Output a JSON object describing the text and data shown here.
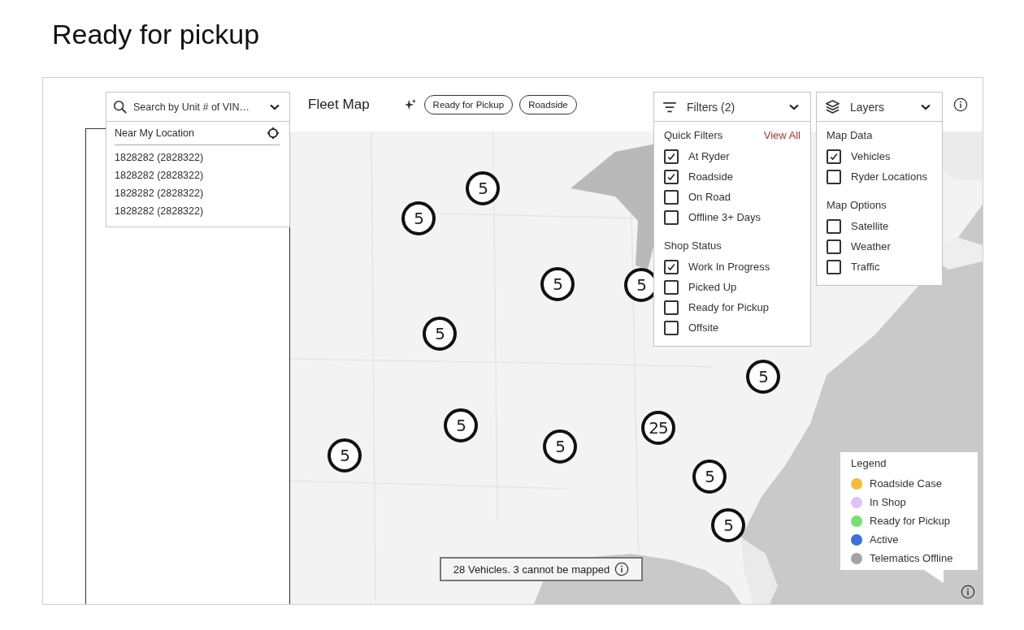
{
  "heading": "Ready for pickup",
  "search": {
    "placeholder": "Search by Unit # of VIN…",
    "near_location": "Near My Location",
    "results": [
      "1828282 (2828322)",
      "1828282 (2828322)",
      "1828282 (2828322)",
      "1828282 (2828322)"
    ]
  },
  "toolbar": {
    "title": "Fleet Map",
    "chips": [
      "Ready for Pickup",
      "Roadside"
    ]
  },
  "filters": {
    "label": "Filters (2)",
    "sections": [
      {
        "title": "Quick Filters",
        "link": "View All",
        "options": [
          {
            "label": "At Ryder",
            "checked": true
          },
          {
            "label": "Roadside",
            "checked": true
          },
          {
            "label": "On Road",
            "checked": false
          },
          {
            "label": "Offline 3+ Days",
            "checked": false
          }
        ]
      },
      {
        "title": "Shop Status",
        "options": [
          {
            "label": "Work In Progress",
            "checked": true
          },
          {
            "label": "Picked Up",
            "checked": false
          },
          {
            "label": "Ready for Pickup",
            "checked": false
          },
          {
            "label": "Offsite",
            "checked": false
          }
        ]
      }
    ]
  },
  "layers": {
    "label": "Layers",
    "sections": [
      {
        "title": "Map Data",
        "options": [
          {
            "label": "Vehicles",
            "checked": true
          },
          {
            "label": "Ryder Locations",
            "checked": false
          }
        ]
      },
      {
        "title": "Map Options",
        "options": [
          {
            "label": "Satellite",
            "checked": false
          },
          {
            "label": "Weather",
            "checked": false
          },
          {
            "label": "Traffic",
            "checked": false
          }
        ]
      }
    ]
  },
  "map": {
    "kind": "picture",
    "clusters": [
      {
        "count": "5"
      },
      {
        "count": "5"
      },
      {
        "count": "5"
      },
      {
        "count": "5"
      },
      {
        "count": "5"
      },
      {
        "count": "5"
      },
      {
        "count": "5"
      },
      {
        "count": "25"
      },
      {
        "count": "5"
      },
      {
        "count": "5"
      },
      {
        "count": "5"
      },
      {
        "count": "5"
      }
    ]
  },
  "status": "28 Vehicles. 3 cannot be mapped",
  "legend": {
    "title": "Legend",
    "items": [
      {
        "label": "Roadside Case",
        "color": "#f5bb3c"
      },
      {
        "label": "In Shop",
        "color": "#dcc3f7"
      },
      {
        "label": "Ready for Pickup",
        "color": "#79dd73"
      },
      {
        "label": "Active",
        "color": "#3b6fe0"
      },
      {
        "label": "Telematics Offline",
        "color": "#a3a3a3"
      }
    ]
  }
}
